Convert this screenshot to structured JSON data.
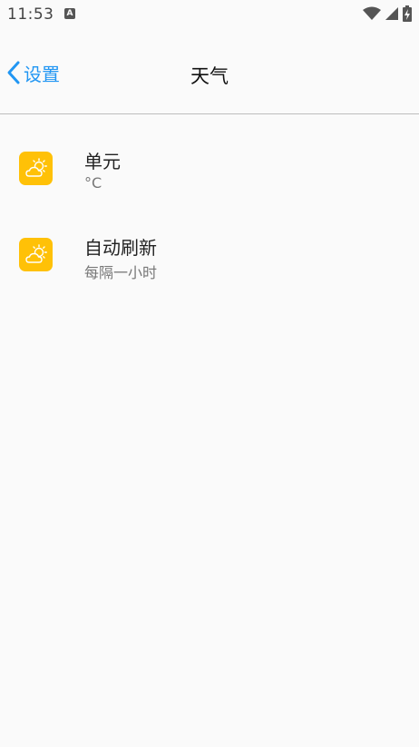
{
  "status_bar": {
    "time": "11:53",
    "notification_letter": "A",
    "icons": [
      "wifi-icon",
      "signal-icon",
      "battery-charging-icon"
    ]
  },
  "app_bar": {
    "back_label": "设置",
    "title": "天气"
  },
  "preferences": [
    {
      "icon": "weather-partly-cloudy-icon",
      "title": "单元",
      "summary": "°C"
    },
    {
      "icon": "weather-partly-cloudy-icon",
      "title": "自动刷新",
      "summary": "每隔一小时"
    }
  ],
  "colors": {
    "accent": "#2196f3",
    "icon_background": "#ffc107",
    "background": "#fafafa",
    "divider": "#bdbdbd"
  }
}
